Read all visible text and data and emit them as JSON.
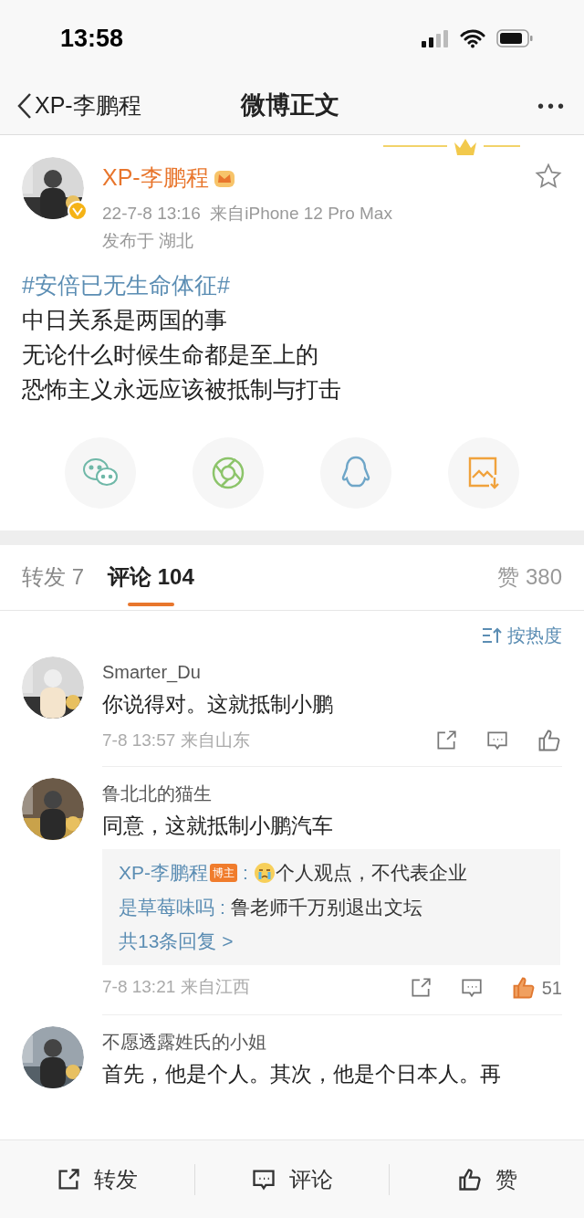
{
  "status_bar": {
    "time": "13:58"
  },
  "nav": {
    "back_label": "XP-李鹏程",
    "title": "微博正文",
    "menu": "•••"
  },
  "post": {
    "author": "XP-李鹏程",
    "verified": true,
    "favorited": false,
    "time_source": "22-7-8 13:16  来自iPhone 12 Pro Max",
    "location": "发布于 湖北",
    "topic": "#安倍已无生命体征#",
    "lines": [
      "中日关系是两国的事",
      "无论什么时候生命都是至上的",
      "恐怖主义永远应该被抵制与打击"
    ]
  },
  "share_targets": [
    {
      "kind": "wechat"
    },
    {
      "kind": "moments"
    },
    {
      "kind": "qq"
    },
    {
      "kind": "save"
    }
  ],
  "tabs": [
    {
      "label": "转发 7",
      "selected": false
    },
    {
      "label": "评论 104",
      "selected": true
    }
  ],
  "likes_total": "赞 380",
  "sort": "按热度",
  "comments": [
    {
      "name": "Smarter_Du",
      "text": "你说得对。这就抵制小鹏",
      "meta": "7-8 13:57 来自山东",
      "liked": false
    },
    {
      "name": "鲁北北的猫生",
      "text": "同意，这就抵制小鹏汽车",
      "replies": [
        {
          "author": "XP-李鹏程",
          "badge": "博主",
          "separator": ":",
          "emoji": true,
          "text": "个人观点，不代表企业"
        },
        {
          "author": "是草莓味吗",
          "separator": ":",
          "emoji": false,
          "text": "鲁老师千万别退出文坛"
        }
      ],
      "more_replies": "共13条回复 >",
      "meta": "7-8 13:21 来自江西",
      "liked": true,
      "like_count": "51"
    },
    {
      "name": "不愿透露姓氏的小姐",
      "text": "首先，他是个人。其次，他是个日本人。再"
    }
  ],
  "bottom_bar": [
    {
      "kind": "repost",
      "label": "转发"
    },
    {
      "kind": "comment",
      "label": "评论"
    },
    {
      "kind": "like",
      "label": "赞"
    }
  ]
}
